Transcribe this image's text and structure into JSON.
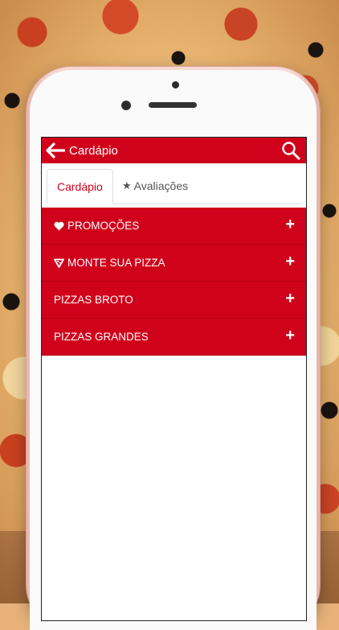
{
  "header": {
    "title": "Cardápio",
    "back_icon": "arrow-left-icon",
    "search_icon": "search-icon"
  },
  "tabs": [
    {
      "label": "Cardápio",
      "active": true
    },
    {
      "label": "Avaliações",
      "icon": "star-icon",
      "active": false
    }
  ],
  "menu": {
    "sections": [
      {
        "label": "PROMOÇÕES",
        "icon": "heart-icon"
      },
      {
        "label": "MONTE SUA PIZZA",
        "icon": "pizza-slice-icon"
      },
      {
        "label": "PIZZAS BROTO"
      },
      {
        "label": "PIZZAS GRANDES"
      }
    ],
    "expand_symbol": "+"
  },
  "colors": {
    "accent": "#d0021b",
    "phone_body": "#f6d6cf"
  }
}
